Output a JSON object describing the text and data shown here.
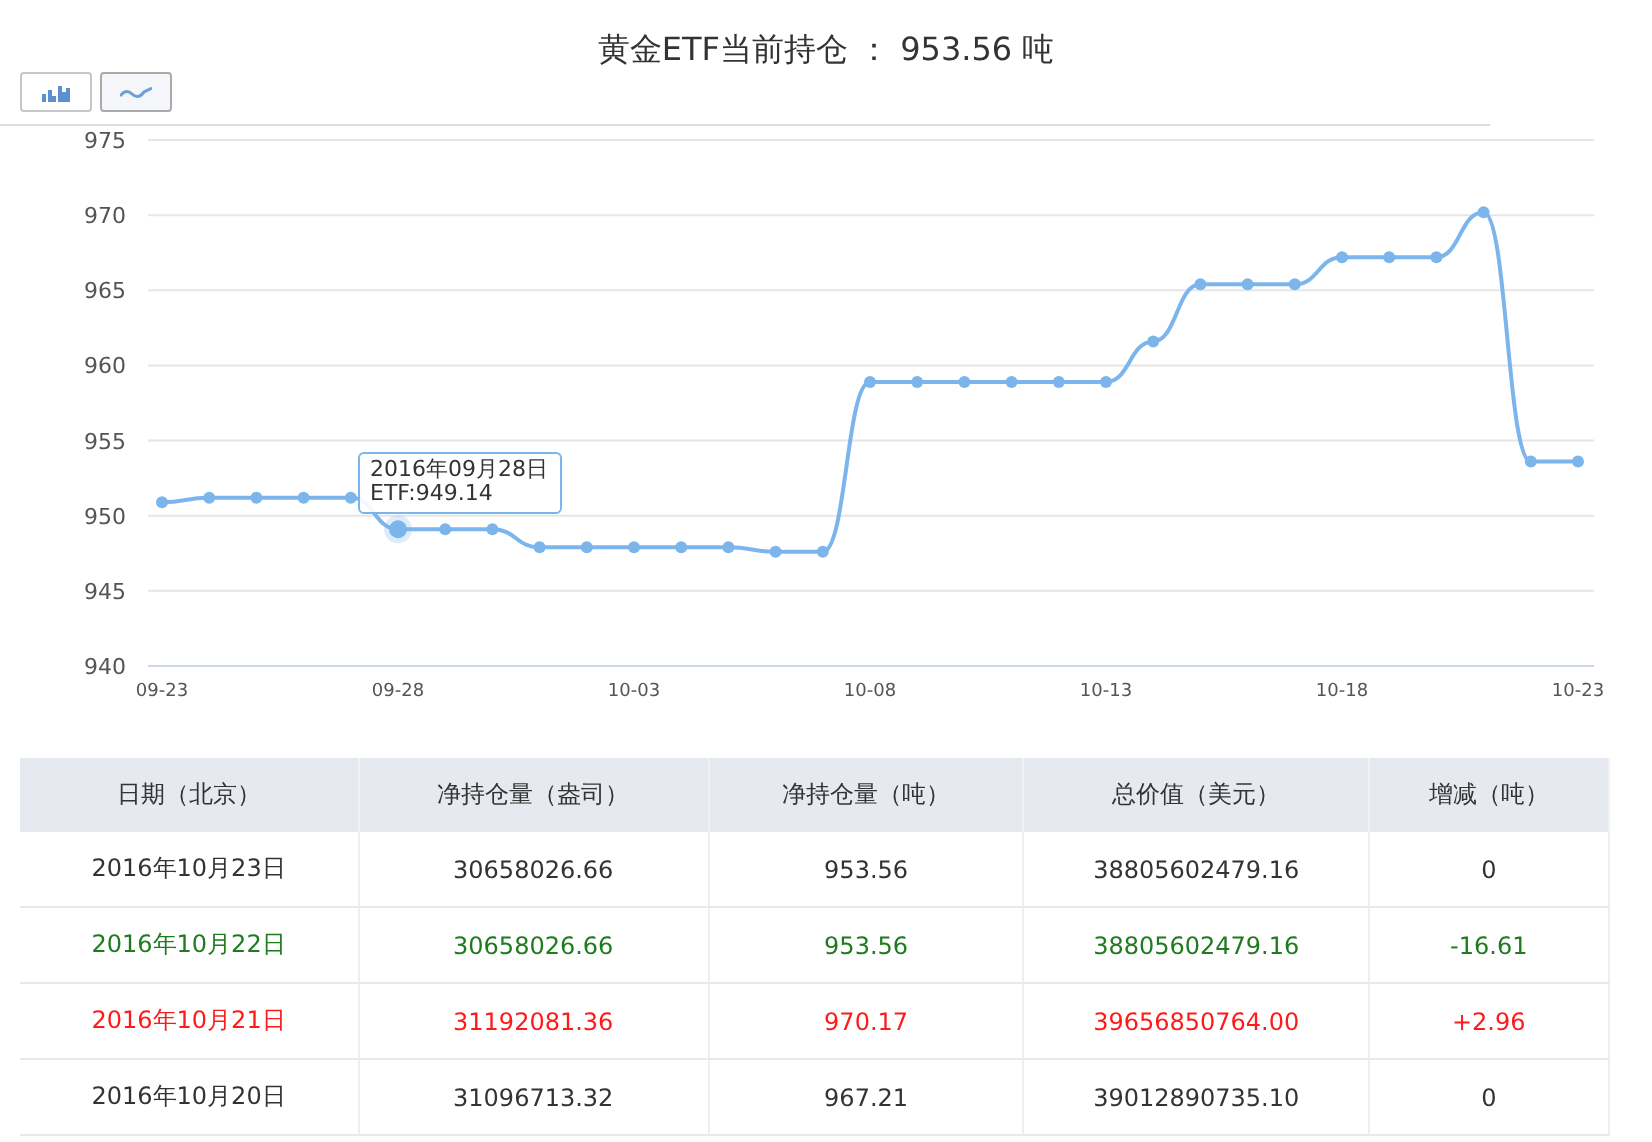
{
  "title": "黄金ETF当前持仓 ： 953.56 吨",
  "toolbar": [
    {
      "kind": "bar",
      "selected": false
    },
    {
      "kind": "line",
      "selected": true
    }
  ],
  "chart": {
    "chart_data": {
      "type": "line",
      "categories": [
        "09-23",
        null,
        null,
        null,
        null,
        "09-28",
        null,
        null,
        null,
        null,
        "10-03",
        null,
        null,
        null,
        null,
        "10-08",
        null,
        null,
        null,
        null,
        "10-13",
        null,
        null,
        null,
        null,
        "10-18",
        null,
        null,
        null,
        null,
        "10-23"
      ],
      "series": [
        {
          "color": "#7cb5ec",
          "marker": true,
          "values": [
            950.9,
            951.2,
            951.2,
            951.2,
            951.2,
            949.1,
            949.1,
            949.1,
            947.9,
            947.9,
            947.9,
            947.9,
            947.9,
            947.6,
            947.6,
            958.9,
            958.9,
            958.9,
            958.9,
            958.9,
            958.9,
            961.6,
            965.4,
            965.4,
            965.4,
            967.2,
            967.2,
            967.2,
            970.2,
            953.6,
            953.6
          ]
        }
      ],
      "grid": true,
      "ylim": [
        940,
        975
      ],
      "yticks": [
        940,
        945,
        950,
        955,
        960,
        965,
        970,
        975
      ]
    },
    "points": [
      {
        "selected": false
      },
      {
        "selected": false
      },
      {
        "selected": false
      },
      {
        "selected": false
      },
      {
        "selected": false
      },
      {
        "selected": true
      },
      {
        "selected": false
      },
      {
        "selected": false
      },
      {
        "selected": false
      },
      {
        "selected": false
      },
      {
        "selected": false
      },
      {
        "selected": false
      },
      {
        "selected": false
      },
      {
        "selected": false
      },
      {
        "selected": false
      },
      {
        "selected": false
      },
      {
        "selected": false
      },
      {
        "selected": false
      },
      {
        "selected": false
      },
      {
        "selected": false
      },
      {
        "selected": false
      },
      {
        "selected": false
      },
      {
        "selected": false
      },
      {
        "selected": false
      },
      {
        "selected": false
      },
      {
        "selected": false
      },
      {
        "selected": false
      },
      {
        "selected": false
      },
      {
        "selected": false
      },
      {
        "selected": false
      },
      {
        "selected": false
      }
    ],
    "tooltip": {
      "date": "2016年09月28日",
      "value": "ETF:949.14"
    }
  },
  "table": {
    "columns": [
      "日期（北京）",
      "净持仓量（盎司）",
      "净持仓量（吨）",
      "总价值（美元）",
      "增减（吨）"
    ],
    "rows": [
      {
        "color": "#333333",
        "cells": [
          "2016年10月23日",
          "30658026.66",
          "953.56",
          "38805602479.16",
          "0"
        ]
      },
      {
        "color": "#1e7b1e",
        "cells": [
          "2016年10月22日",
          "30658026.66",
          "953.56",
          "38805602479.16",
          "-16.61"
        ]
      },
      {
        "color": "#ff1a1a",
        "cells": [
          "2016年10月21日",
          "31192081.36",
          "970.17",
          "39656850764.00",
          "+2.96"
        ]
      },
      {
        "color": "#333333",
        "cells": [
          "2016年10月20日",
          "31096713.32",
          "967.21",
          "39012890735.10",
          "0"
        ]
      }
    ]
  }
}
